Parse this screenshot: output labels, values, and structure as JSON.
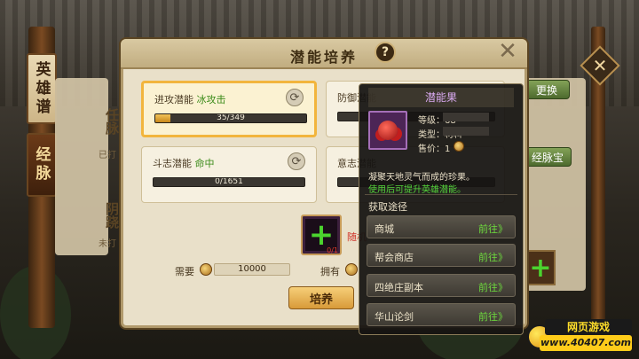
{
  "side_tabs": [
    "英雄谱",
    "经脉"
  ],
  "background_panel": {
    "meridian_1_name": "任脉",
    "meridian_1_status": "已打",
    "meridian_2_name": "阴跷",
    "meridian_2_status": "未打",
    "replace_button": "更换",
    "treasure_button": "经脉宝"
  },
  "dialog": {
    "title": "潜能培养",
    "help_icon": "?",
    "close_icon": "✕",
    "cards": [
      {
        "label": "进攻潜能",
        "value": "冰攻击",
        "progress_text": "35/349",
        "progress": 0.1
      },
      {
        "label": "防御潜能",
        "value": "",
        "progress_text": "",
        "progress": 0
      },
      {
        "label": "斗志潜能",
        "value": "命中",
        "progress_text": "0/1651",
        "progress": 0
      },
      {
        "label": "意志潜能",
        "value": "",
        "progress_text": "",
        "progress": 0
      }
    ],
    "item_slot": {
      "count": "0/1",
      "random_text": "随机"
    },
    "cost_label": "需要",
    "cost_value": "10000",
    "owned_label": "拥有",
    "train_button": "培养"
  },
  "tooltip": {
    "title": "潜能果",
    "level_label": "等级：68",
    "type_label": "类型：材料",
    "price_label": "售价：1",
    "desc_1": "凝聚天地灵气而成的珍果。",
    "desc_2": "使用后可提升英雄潜能。",
    "sources_title": "获取途径",
    "sources": [
      {
        "name": "商城",
        "action": "前往》"
      },
      {
        "name": "帮会商店",
        "action": "前往》"
      },
      {
        "name": "四绝庄副本",
        "action": "前往》"
      },
      {
        "name": "华山论剑",
        "action": "前往》"
      }
    ]
  },
  "watermark": {
    "top": "网页游戏",
    "bottom": "www.40407.com"
  }
}
